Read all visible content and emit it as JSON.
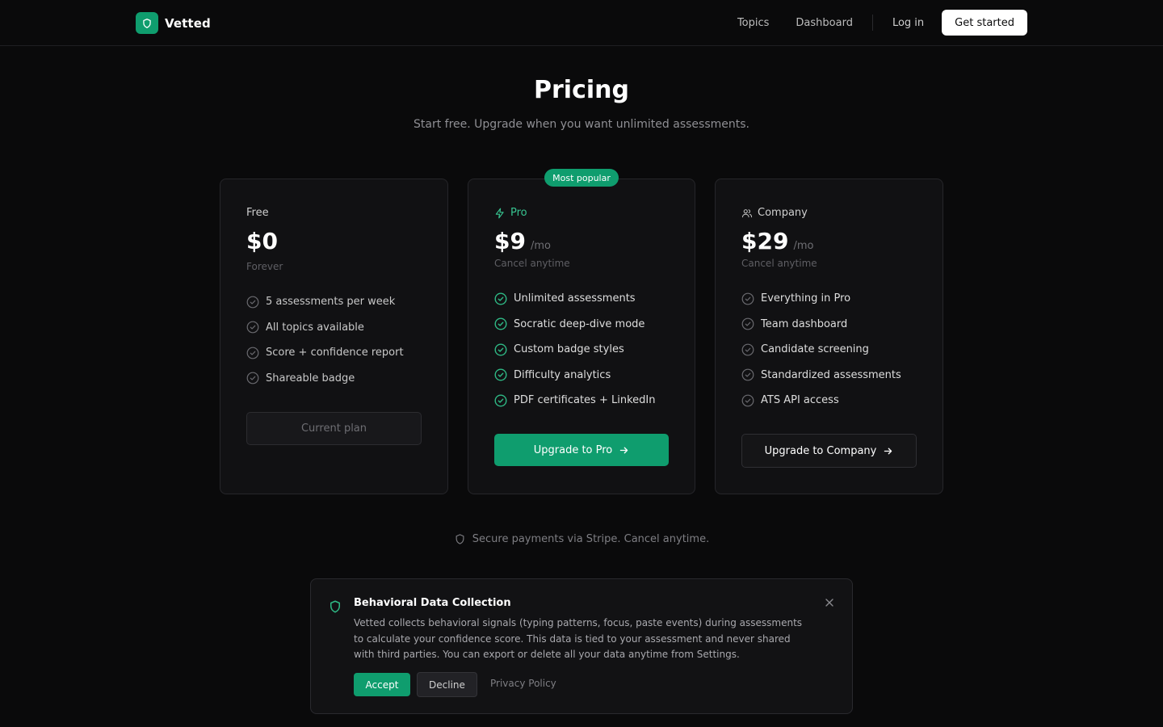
{
  "header": {
    "brand": "Vetted",
    "nav": [
      "Topics",
      "Dashboard"
    ],
    "login": "Log in",
    "cta": "Get started"
  },
  "hero": {
    "title": "Pricing",
    "subtitle": "Start free. Upgrade when you want unlimited assessments."
  },
  "plans": {
    "free": {
      "name": "Free",
      "price": "$0",
      "note": "Forever",
      "features": [
        "5 assessments per week",
        "All topics available",
        "Score + confidence report",
        "Shareable badge"
      ],
      "button": "Current plan"
    },
    "pro": {
      "badge": "Most popular",
      "icon": "bolt-icon",
      "name": "Pro",
      "price": "$9",
      "period": "/mo",
      "note": "Cancel anytime",
      "features": [
        "Unlimited assessments",
        "Socratic deep-dive mode",
        "Custom badge styles",
        "Difficulty analytics",
        "PDF certificates + LinkedIn"
      ],
      "button": "Upgrade to Pro"
    },
    "company": {
      "icon": "users-icon",
      "name": "Company",
      "price": "$29",
      "period": "/mo",
      "note": "Cancel anytime",
      "features": [
        "Everything in Pro",
        "Team dashboard",
        "Candidate screening",
        "Standardized assessments",
        "ATS API access"
      ],
      "button": "Upgrade to Company"
    }
  },
  "secure_note": "Secure payments via Stripe. Cancel anytime.",
  "consent": {
    "title": "Behavioral Data Collection",
    "body": "Vetted collects behavioral signals (typing patterns, focus, paste events) during assessments to calculate your confidence score. This data is tied to your assessment and never shared with third parties. You can export or delete all your data anytime from Settings.",
    "accept": "Accept",
    "decline": "Decline",
    "privacy": "Privacy Policy"
  },
  "colors": {
    "background": "#0a0a0b",
    "accent": "#0f9d6e",
    "accent_text": "#37c490",
    "card": "#111113"
  }
}
